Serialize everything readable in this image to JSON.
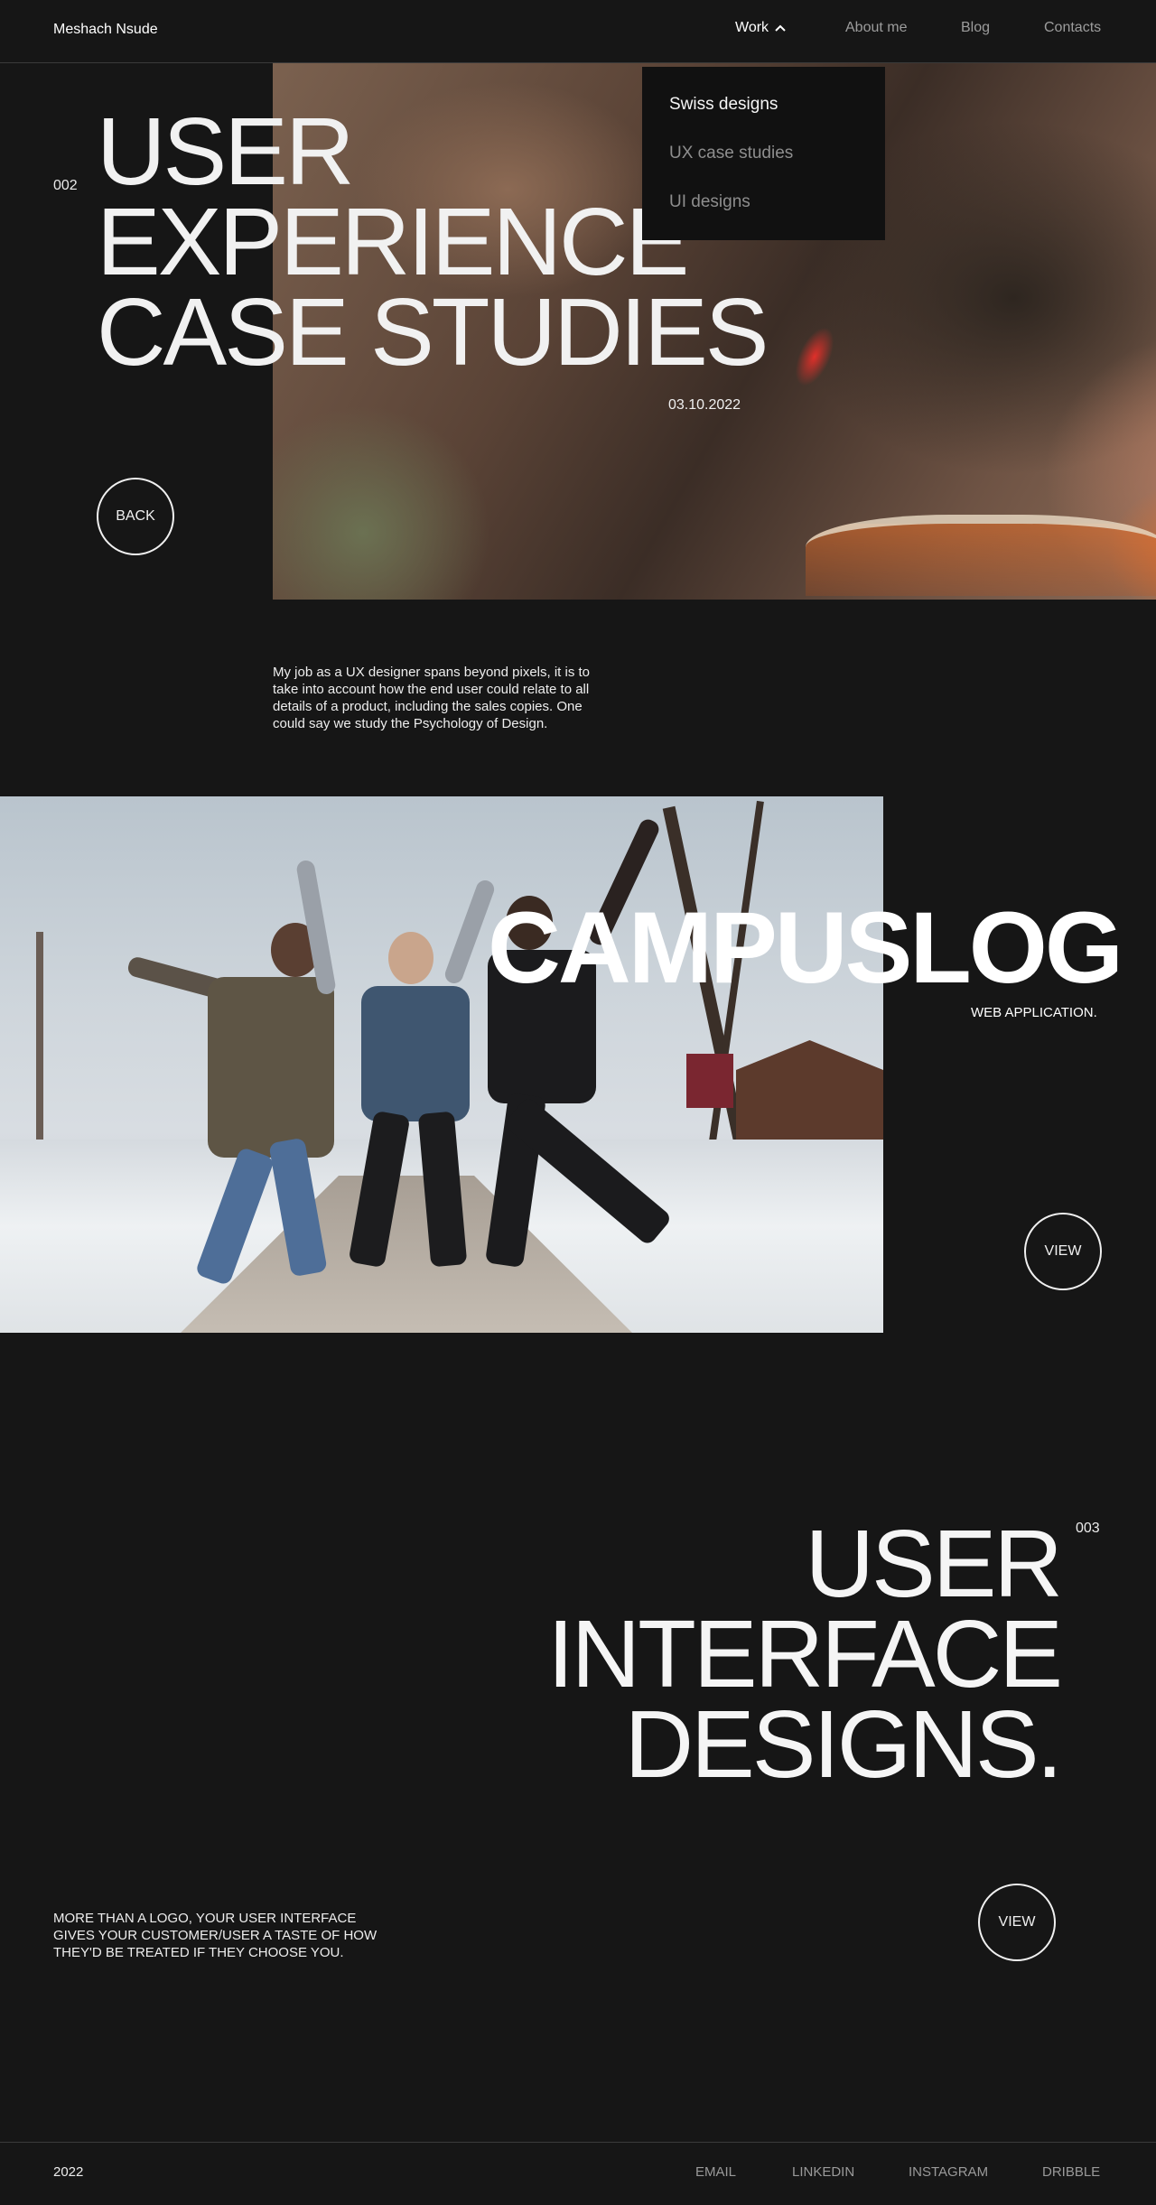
{
  "header": {
    "brand": "Meshach Nsude",
    "nav": {
      "work": "Work",
      "about": "About me",
      "blog": "Blog",
      "contacts": "Contacts"
    }
  },
  "dropdown": {
    "items": [
      "Swiss designs",
      "UX case studies",
      "UI designs"
    ],
    "active_index": 0
  },
  "hero": {
    "number": "002",
    "title_lines": [
      "USER",
      "EXPERIENCE",
      "CASE STUDIES"
    ],
    "date": "03.10.2022",
    "back_label": "BACK",
    "intro": "My job as a UX designer spans beyond pixels, it  is to take into account how the end user could relate to all details of  a product, including the sales copies. One could say we study the Psychology of Design."
  },
  "campuslog": {
    "title": "CAMPUSLOG",
    "subtitle": "WEB APPLICATION.",
    "view_label": "VIEW"
  },
  "ui_section": {
    "number": "003",
    "title_lines": [
      "USER",
      "INTERFACE",
      "DESIGNS."
    ],
    "description": "MORE THAN A LOGO, YOUR USER INTERFACE GIVES YOUR  CUSTOMER/USER A TASTE OF HOW THEY'D BE TREATED IF THEY CHOOSE YOU.",
    "view_label": "VIEW"
  },
  "footer": {
    "year": "2022",
    "links": [
      "EMAIL",
      "LINKEDIN",
      "INSTAGRAM",
      "DRIBBLE"
    ]
  }
}
